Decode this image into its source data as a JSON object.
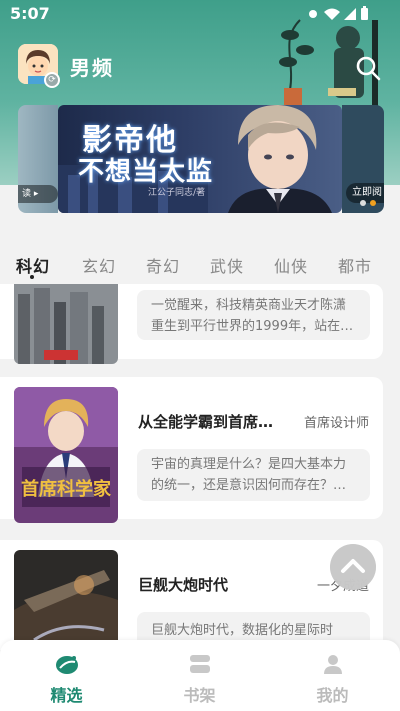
{
  "status_bar": {
    "time": "5:07"
  },
  "header": {
    "title": "男频",
    "avatar": "avatar-boy-icon",
    "search_icon": "search-icon",
    "accent": "#3f9f8a"
  },
  "banner": {
    "title_line1": "影帝他",
    "title_line2": "不想当太监",
    "author": "江公子同志/著",
    "left_peek_label": "读 ▸",
    "right_peek_label": "立即阅"
  },
  "categories": [
    "科幻",
    "玄幻",
    "奇幻",
    "武侠",
    "仙侠",
    "都市"
  ],
  "active_category": "科幻",
  "books": [
    {
      "title": "",
      "author": "",
      "synopsis": "一觉醒来，科技精英商业天才陈潇重生到平行世界的1999年，站在…"
    },
    {
      "title": "从全能学霸到首席…",
      "author": "首席设计师",
      "cover_text": "首席科学家",
      "synopsis": "宇宙的真理是什么？是四大基本力的统一，还是意识因何而存在？…"
    },
    {
      "title": "巨舰大炮时代",
      "author": "一夕成道",
      "synopsis": "巨舰大炮时代，数据化的星际时"
    }
  ],
  "tabbar": {
    "tabs": [
      {
        "label": "精选",
        "icon": "discover-icon"
      },
      {
        "label": "书架",
        "icon": "bookshelf-icon"
      },
      {
        "label": "我的",
        "icon": "profile-icon"
      }
    ],
    "active": "精选",
    "active_color": "#1f8a72"
  }
}
